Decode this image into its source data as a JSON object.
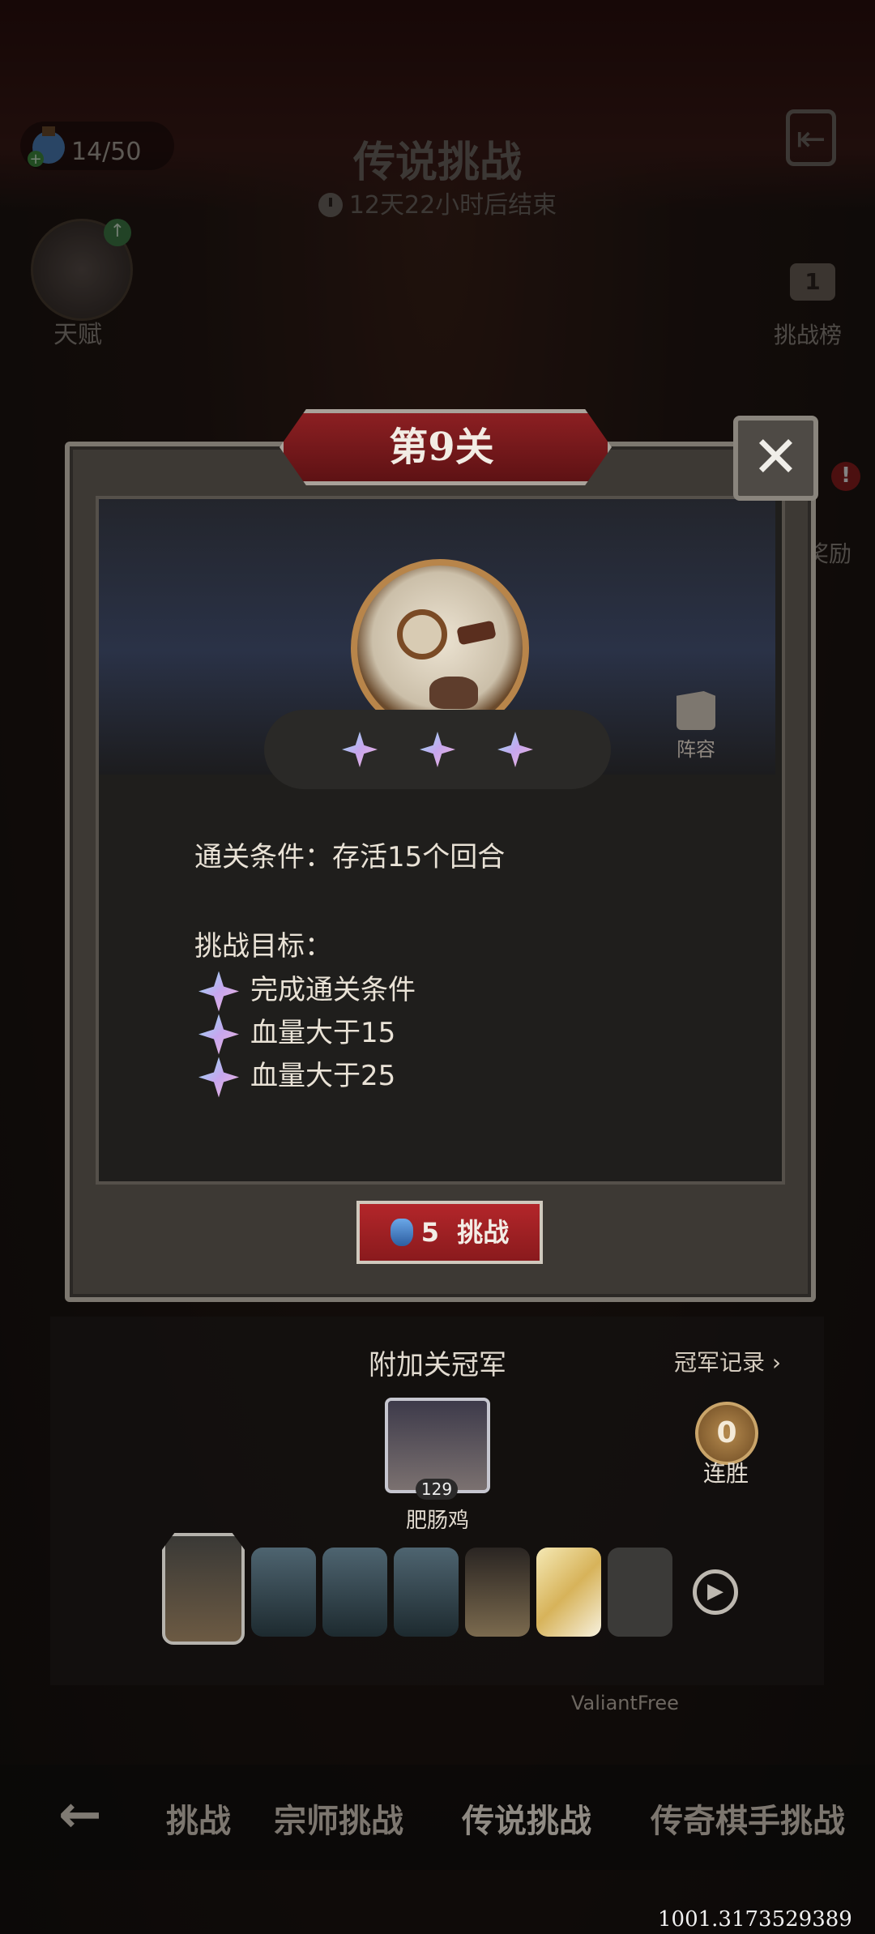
{
  "header": {
    "stamina": "14/50",
    "title": "传说挑战",
    "countdown": "12天22小时后结束",
    "talent_label": "天赋",
    "rank_label": "挑战榜",
    "rank_number": "1",
    "reward_label": "奖励"
  },
  "modal": {
    "stage_title": "第9关",
    "lineup_label": "阵容",
    "clear_condition": "通关条件：存活15个回合",
    "goals_heading": "挑战目标：",
    "goals": [
      "完成通关条件",
      "血量大于15",
      "血量大于25"
    ],
    "challenge_cost": "5",
    "challenge_label": "挑战"
  },
  "champion": {
    "title": "附加关冠军",
    "record_link": "冠军记录",
    "level": "129",
    "name": "肥肠鸡",
    "streak_count": "0",
    "streak_label": "连胜"
  },
  "watermark": "ValiantFree",
  "tabs": [
    "挑战",
    "宗师挑战",
    "传说挑战",
    "传奇棋手挑战"
  ],
  "footer_id": "1001.3173529389"
}
